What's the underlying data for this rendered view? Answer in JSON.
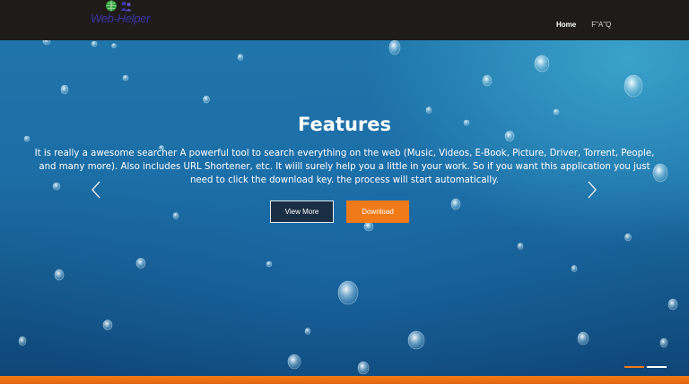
{
  "brand": {
    "name": "Web-Helper"
  },
  "nav": {
    "items": [
      {
        "label": "Home"
      },
      {
        "label": "F\"A\"Q"
      }
    ]
  },
  "hero": {
    "title": "Features",
    "description": "It is really a awesome searcher A powerful tool to search everything on the web (Music, Videos, E-Book, Picture, Driver, Torrent, People, and many more). Also includes URL Shortener, etc. It wiill surely help you a little in your work. So if you want this application you just need to click the download key. the process will start automatically.",
    "buttons": {
      "view_more": "View More",
      "download": "Download"
    },
    "slides": {
      "count": 2,
      "active_index": 0
    }
  },
  "colors": {
    "accent": "#f07a18",
    "header_bg": "#1e1b18",
    "hero_blue": "#1f74a9",
    "logo_text": "#3a35a8"
  },
  "icons": {
    "logo": "globe-people-icon",
    "prev": "chevron-left-icon",
    "next": "chevron-right-icon"
  }
}
